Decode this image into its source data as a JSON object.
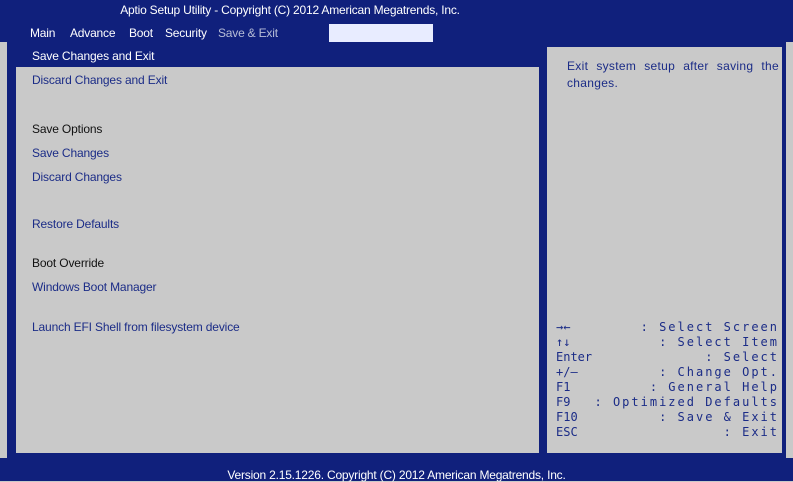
{
  "header": {
    "title": "Aptio Setup Utility - Copyright (C) 2012 American Megatrends, Inc.",
    "tabs": [
      {
        "label": "Main"
      },
      {
        "label": "Advance"
      },
      {
        "label": "Boot"
      },
      {
        "label": "Security"
      },
      {
        "label": "Save & Exit"
      }
    ],
    "active_tab": "Save & Exit"
  },
  "menu": {
    "items": [
      {
        "label": "Save Changes and Exit",
        "selected": true
      },
      {
        "label": "Discard Changes and Exit"
      },
      {
        "heading": "Save Options"
      },
      {
        "label": "Save Changes"
      },
      {
        "label": "Discard Changes"
      },
      {
        "label": "Restore Defaults"
      },
      {
        "heading": "Boot Override"
      },
      {
        "label": "Windows Boot Manager"
      },
      {
        "label": "Launch EFI Shell from filesystem device"
      }
    ]
  },
  "help": {
    "text": "Exit system setup after saving the changes."
  },
  "keys": [
    {
      "key": "→←",
      "desc": ": Select Screen"
    },
    {
      "key": "↑↓",
      "desc": ": Select Item"
    },
    {
      "key": "Enter",
      "desc": ": Select"
    },
    {
      "key": "+/—",
      "desc": ": Change Opt."
    },
    {
      "key": "F1",
      "desc": ": General Help"
    },
    {
      "key": "F9",
      "desc": ": Optimized Defaults"
    },
    {
      "key": "F10",
      "desc": ": Save & Exit"
    },
    {
      "key": "ESC",
      "desc": ": Exit"
    }
  ],
  "footer": {
    "version": "Version 2.15.1226. Copyright (C) 2012 American Megatrends, Inc."
  },
  "colors": {
    "frame_blue": "#10207c",
    "background_gray": "#c9c9c9",
    "text_blue": "#1b2c87",
    "white": "#ffffff"
  }
}
